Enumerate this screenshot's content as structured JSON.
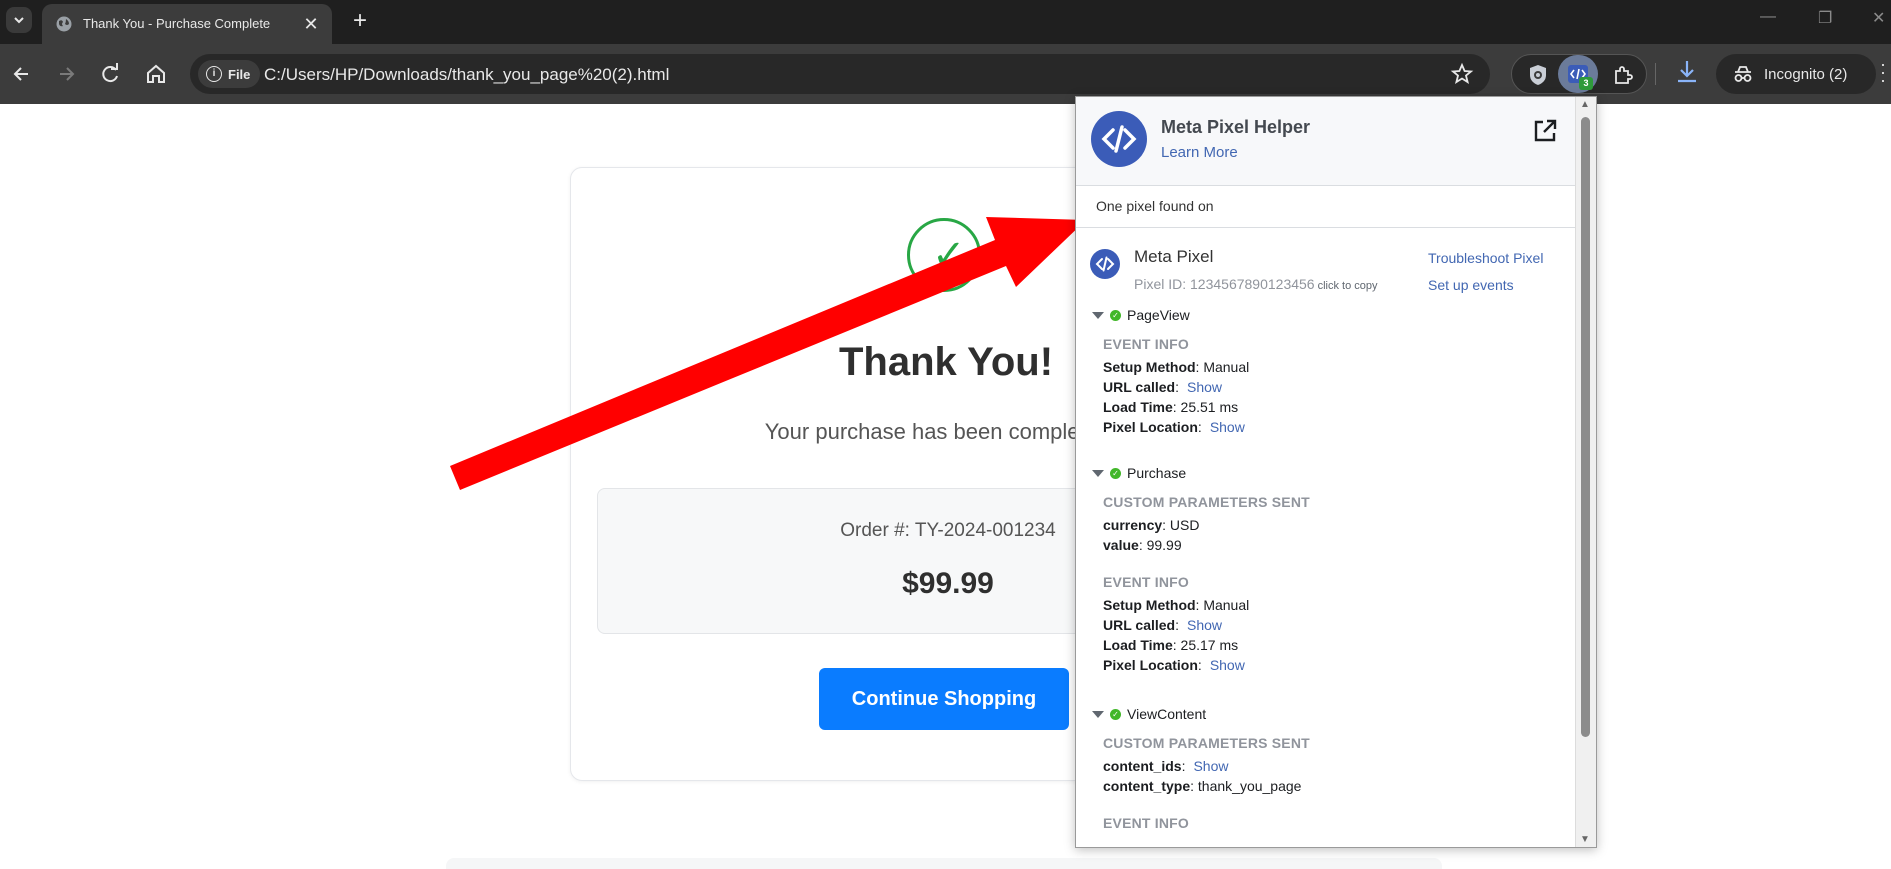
{
  "browser": {
    "tab_title": "Thank You - Purchase Complete",
    "new_tab_label": "+",
    "file_chip_label": "File",
    "url": "C:/Users/HP/Downloads/thank_you_page%20(2).html",
    "incognito_label": "Incognito (2)",
    "extension_badge_count": "3"
  },
  "page": {
    "check_mark": "✓",
    "heading": "Thank You!",
    "subtitle": "Your purchase has been completed s",
    "order_number": "Order #: TY-2024-001234",
    "price": "$99.99",
    "continue_button": "Continue Shopping"
  },
  "popup": {
    "title": "Meta Pixel Helper",
    "learn_more": "Learn More",
    "found_text": "One pixel found on",
    "pixel_name": "Meta Pixel",
    "pixel_id": "Pixel ID: 1234567890123456",
    "click_to_copy": "click to copy",
    "troubleshoot": "Troubleshoot Pixel",
    "setup_events": "Set up events",
    "events": [
      {
        "name": "PageView",
        "event_info_title": "EVENT INFO",
        "setup_method_label": "Setup Method",
        "setup_method_value": ": Manual",
        "url_called_label": "URL called",
        "url_called_link": "Show",
        "load_time_label": "Load Time",
        "load_time_value": ": 25.51 ms",
        "pixel_location_label": "Pixel Location",
        "pixel_location_link": "Show"
      },
      {
        "name": "Purchase",
        "custom_title": "CUSTOM PARAMETERS SENT",
        "currency_label": "currency",
        "currency_value": ": USD",
        "value_label": "value",
        "value_value": ": 99.99",
        "event_info_title": "EVENT INFO",
        "setup_method_label": "Setup Method",
        "setup_method_value": ": Manual",
        "url_called_label": "URL called",
        "url_called_link": "Show",
        "load_time_label": "Load Time",
        "load_time_value": ": 25.17 ms",
        "pixel_location_label": "Pixel Location",
        "pixel_location_link": "Show"
      },
      {
        "name": "ViewContent",
        "custom_title": "CUSTOM PARAMETERS SENT",
        "content_ids_label": "content_ids",
        "content_ids_link": "Show",
        "content_type_label": "content_type",
        "content_type_value": ": thank_you_page",
        "event_info_title": "EVENT INFO"
      }
    ]
  },
  "colors": {
    "arrow": "#ff0000",
    "brand_blue": "#3b5cb8",
    "link_blue": "#4267b2",
    "button_blue": "#0a7cff",
    "success_green": "#28a745"
  }
}
